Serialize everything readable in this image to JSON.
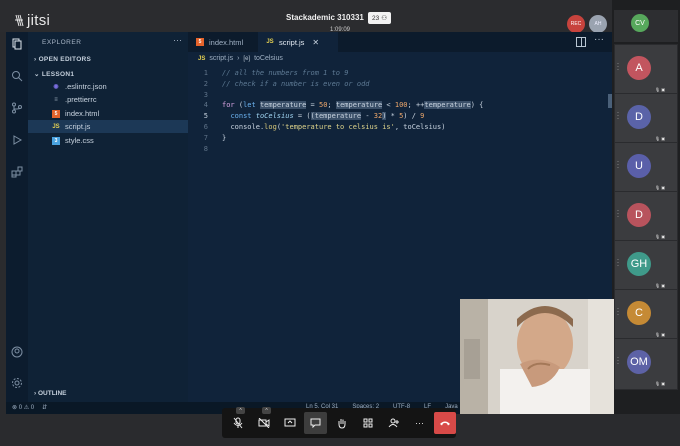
{
  "jitsi": {
    "logo": "jitsi",
    "meeting_title": "Stackademic 310331",
    "participant_count": "23",
    "timer": "1:09:09",
    "rec_label": "REC",
    "self_initials": "AH"
  },
  "vscode": {
    "sidebar": {
      "header": "EXPLORER",
      "open_editors": "OPEN EDITORS",
      "project": "LESSON1",
      "files": [
        {
          "name": ".eslintrc.json",
          "icon": "eslint-icon",
          "color": "#7b6ee0"
        },
        {
          "name": ".prettierrc",
          "icon": "prettier-icon",
          "color": "#9aa8b6"
        },
        {
          "name": "index.html",
          "icon": "html-icon",
          "color": "#e4632b"
        },
        {
          "name": "script.js",
          "icon": "js-icon",
          "color": "#e6d252"
        },
        {
          "name": "style.css",
          "icon": "css-icon",
          "color": "#4aa3e0"
        }
      ],
      "outline": "OUTLINE"
    },
    "tabs": [
      {
        "label": "index.html",
        "icon": "html-icon"
      },
      {
        "label": "script.js",
        "icon": "js-icon"
      }
    ],
    "breadcrumb": {
      "file": "script.js",
      "symbol": "toCelsius"
    },
    "line_numbers": [
      "1",
      "2",
      "3",
      "4",
      "5",
      "6",
      "7",
      "8"
    ],
    "status": {
      "problems": "⊗ 0 ⚠ 0",
      "cursor": "Ln 5, Col 31",
      "spaces": "Spaces: 2",
      "encoding": "UTF-8",
      "eol": "LF",
      "lang": "Java"
    }
  },
  "filmstrip": {
    "top_initials": "CV",
    "tiles": [
      {
        "initials": "A",
        "color": "#c2555f"
      },
      {
        "initials": "D",
        "color": "#5a63a8"
      },
      {
        "initials": "U",
        "color": "#5a5fa9"
      },
      {
        "initials": "D",
        "color": "#b8535d"
      },
      {
        "initials": "GH",
        "color": "#3f9a8a"
      },
      {
        "initials": "C",
        "color": "#c58a35"
      },
      {
        "initials": "OM",
        "color": "#5d62a6"
      }
    ]
  },
  "toolbar": {
    "buttons": [
      "mic-off-icon",
      "camera-off-icon",
      "screen-share-icon",
      "chat-icon",
      "raise-hand-icon",
      "tile-view-icon",
      "invite-icon",
      "more-icon",
      "hangup-icon"
    ]
  }
}
